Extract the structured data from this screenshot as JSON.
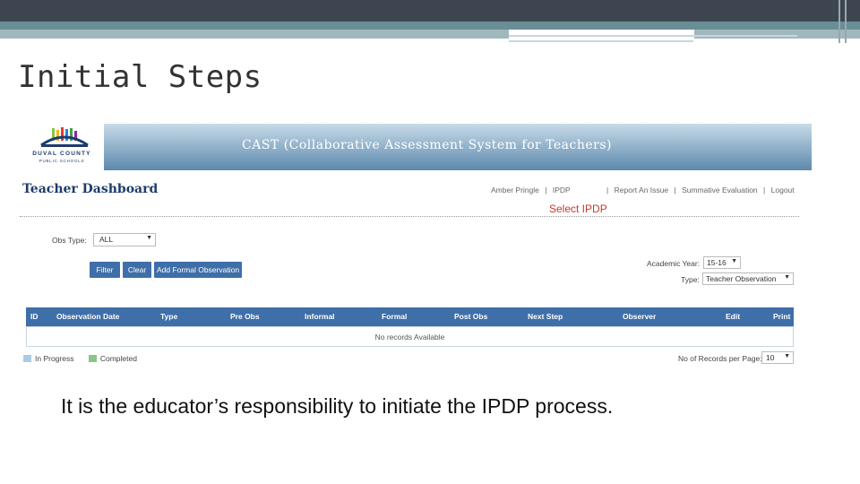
{
  "slide": {
    "title": "Initial Steps",
    "caption": "It is the educator’s responsibility to initiate the IPDP process."
  },
  "logo": {
    "line1": "DUVAL COUNTY",
    "line2": "PUBLIC SCHOOLS"
  },
  "banner": {
    "title": "CAST (Collaborative Assessment System for Teachers)"
  },
  "dashboard": {
    "title": "Teacher Dashboard",
    "user_links": [
      "Amber Pringle",
      "|",
      "IPDP",
      "|",
      "Report An Issue",
      "|",
      "Summative Evaluation",
      "|",
      "Logout"
    ],
    "callout": "Select IPDP"
  },
  "filters": {
    "obs_type_label": "Obs Type:",
    "obs_type_value": "ALL",
    "buttons": [
      "Filter",
      "Clear",
      "Add Formal Observation"
    ],
    "academic_year_label": "Academic Year:",
    "academic_year_value": "15-16",
    "type_label": "Type:",
    "type_value": "Teacher Observation"
  },
  "table": {
    "columns": [
      "ID",
      "Observation Date",
      "Type",
      "Pre Obs",
      "Informal",
      "Formal",
      "Post Obs",
      "Next Step",
      "Observer",
      "Edit",
      "Print"
    ],
    "empty_message": "No records Available"
  },
  "legend": {
    "items": [
      {
        "label": "In Progress",
        "color": "#a9cbe6"
      },
      {
        "label": "Completed",
        "color": "#8bc48a"
      }
    ]
  },
  "pagination": {
    "label": "No of Records per Page:",
    "value": "10"
  },
  "colors": {
    "header_blue": "#3f6fa8",
    "callout_red": "#c8372f",
    "slide_bar": "#3d4650"
  }
}
